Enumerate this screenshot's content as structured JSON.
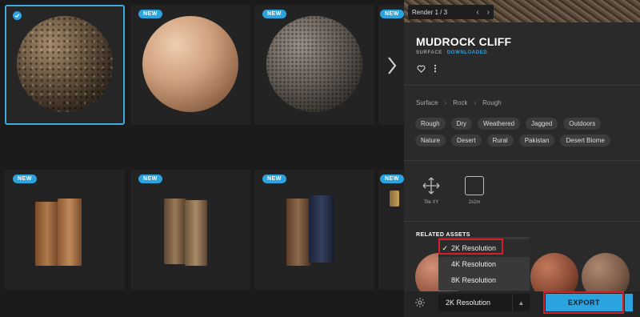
{
  "grid": {
    "new_badge": "NEW",
    "cards": [
      {
        "type": "sphere",
        "material": "rock",
        "selected": true,
        "new": false
      },
      {
        "type": "sphere",
        "material": "wood",
        "selected": false,
        "new": true
      },
      {
        "type": "sphere",
        "material": "stone",
        "selected": false,
        "new": true
      },
      {
        "type": "books",
        "selected": false,
        "new": true
      },
      {
        "type": "books",
        "selected": false,
        "new": true
      },
      {
        "type": "books",
        "selected": false,
        "new": true
      }
    ]
  },
  "panel": {
    "render_nav": {
      "label": "Render 1 / 3",
      "prev_icon": "chevron-left-icon",
      "next_icon": "chevron-right-icon"
    },
    "title": "MUDROCK CLIFF",
    "subtitle_primary": "SURFACE",
    "subtitle_status": "DOWNLOADED",
    "icons": {
      "favorite": "heart-icon",
      "more": "more-vertical-icon"
    },
    "breadcrumb": [
      "Surface",
      "Rock",
      "Rough"
    ],
    "tags": [
      "Rough",
      "Dry",
      "Weathered",
      "Jagged",
      "Outdoors",
      "Nature",
      "Desert",
      "Rural",
      "Pakistan",
      "Desert Biome"
    ],
    "tools": [
      {
        "icon": "move-arrows-icon",
        "label": "Tile XY"
      },
      {
        "icon": "square-icon",
        "label": "2x2m"
      }
    ],
    "related_title": "RELATED ASSETS"
  },
  "resolution_menu": {
    "options": [
      "2K Resolution",
      "4K Resolution",
      "8K Resolution"
    ],
    "selected": "2K Resolution",
    "check": "✓"
  },
  "footer": {
    "settings_icon": "gear-icon",
    "select_value": "2K Resolution",
    "select_icon": "chevron-up-icon",
    "export_label": "EXPORT"
  },
  "colors": {
    "accent": "#2aa3df",
    "highlight": "#d1202a",
    "panel": "#2a2a2a",
    "background": "#1b1b1b"
  }
}
